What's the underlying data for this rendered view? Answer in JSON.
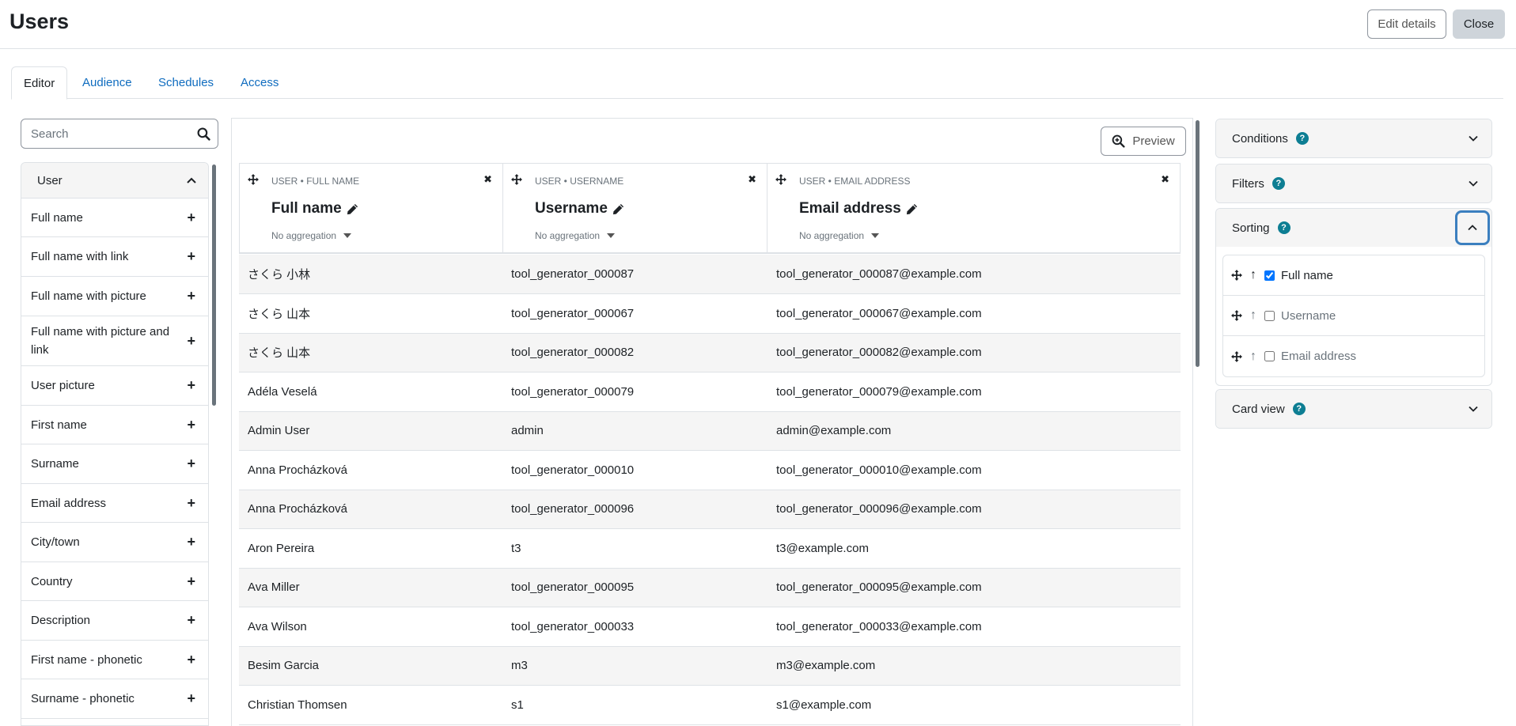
{
  "header": {
    "title": "Users",
    "edit_details_label": "Edit details",
    "close_label": "Close"
  },
  "tabs": [
    "Editor",
    "Audience",
    "Schedules",
    "Access"
  ],
  "search": {
    "placeholder": "Search"
  },
  "sidebar": {
    "group_label": "User",
    "items": [
      "Full name",
      "Full name with link",
      "Full name with picture",
      "Full name with picture and link",
      "User picture",
      "First name",
      "Surname",
      "Email address",
      "City/town",
      "Country",
      "Description",
      "First name - phonetic",
      "Surname - phonetic"
    ]
  },
  "preview_label": "Preview",
  "columns": [
    {
      "source": "USER • FULL NAME",
      "title": "Full name",
      "aggregation": "No aggregation"
    },
    {
      "source": "USER • USERNAME",
      "title": "Username",
      "aggregation": "No aggregation"
    },
    {
      "source": "USER • EMAIL ADDRESS",
      "title": "Email address",
      "aggregation": "No aggregation"
    }
  ],
  "rows": [
    [
      "さくら 小林",
      "tool_generator_000087",
      "tool_generator_000087@example.com"
    ],
    [
      "さくら 山本",
      "tool_generator_000067",
      "tool_generator_000067@example.com"
    ],
    [
      "さくら 山本",
      "tool_generator_000082",
      "tool_generator_000082@example.com"
    ],
    [
      "Adéla Veselá",
      "tool_generator_000079",
      "tool_generator_000079@example.com"
    ],
    [
      "Admin User",
      "admin",
      "admin@example.com"
    ],
    [
      "Anna Procházková",
      "tool_generator_000010",
      "tool_generator_000010@example.com"
    ],
    [
      "Anna Procházková",
      "tool_generator_000096",
      "tool_generator_000096@example.com"
    ],
    [
      "Aron Pereira",
      "t3",
      "t3@example.com"
    ],
    [
      "Ava Miller",
      "tool_generator_000095",
      "tool_generator_000095@example.com"
    ],
    [
      "Ava Wilson",
      "tool_generator_000033",
      "tool_generator_000033@example.com"
    ],
    [
      "Besim Garcia",
      "m3",
      "m3@example.com"
    ],
    [
      "Christian Thomsen",
      "s1",
      "s1@example.com"
    ]
  ],
  "right_panel": {
    "conditions_label": "Conditions",
    "filters_label": "Filters",
    "sorting_label": "Sorting",
    "card_view_label": "Card view",
    "help_glyph": "?",
    "sort_items": [
      {
        "label": "Full name",
        "checked": true
      },
      {
        "label": "Username",
        "checked": false
      },
      {
        "label": "Email address",
        "checked": false
      }
    ]
  },
  "colors": {
    "link": "#0f6cbf",
    "help_badge": "#0d7e93",
    "focus_ring": "#3b7fbf"
  }
}
